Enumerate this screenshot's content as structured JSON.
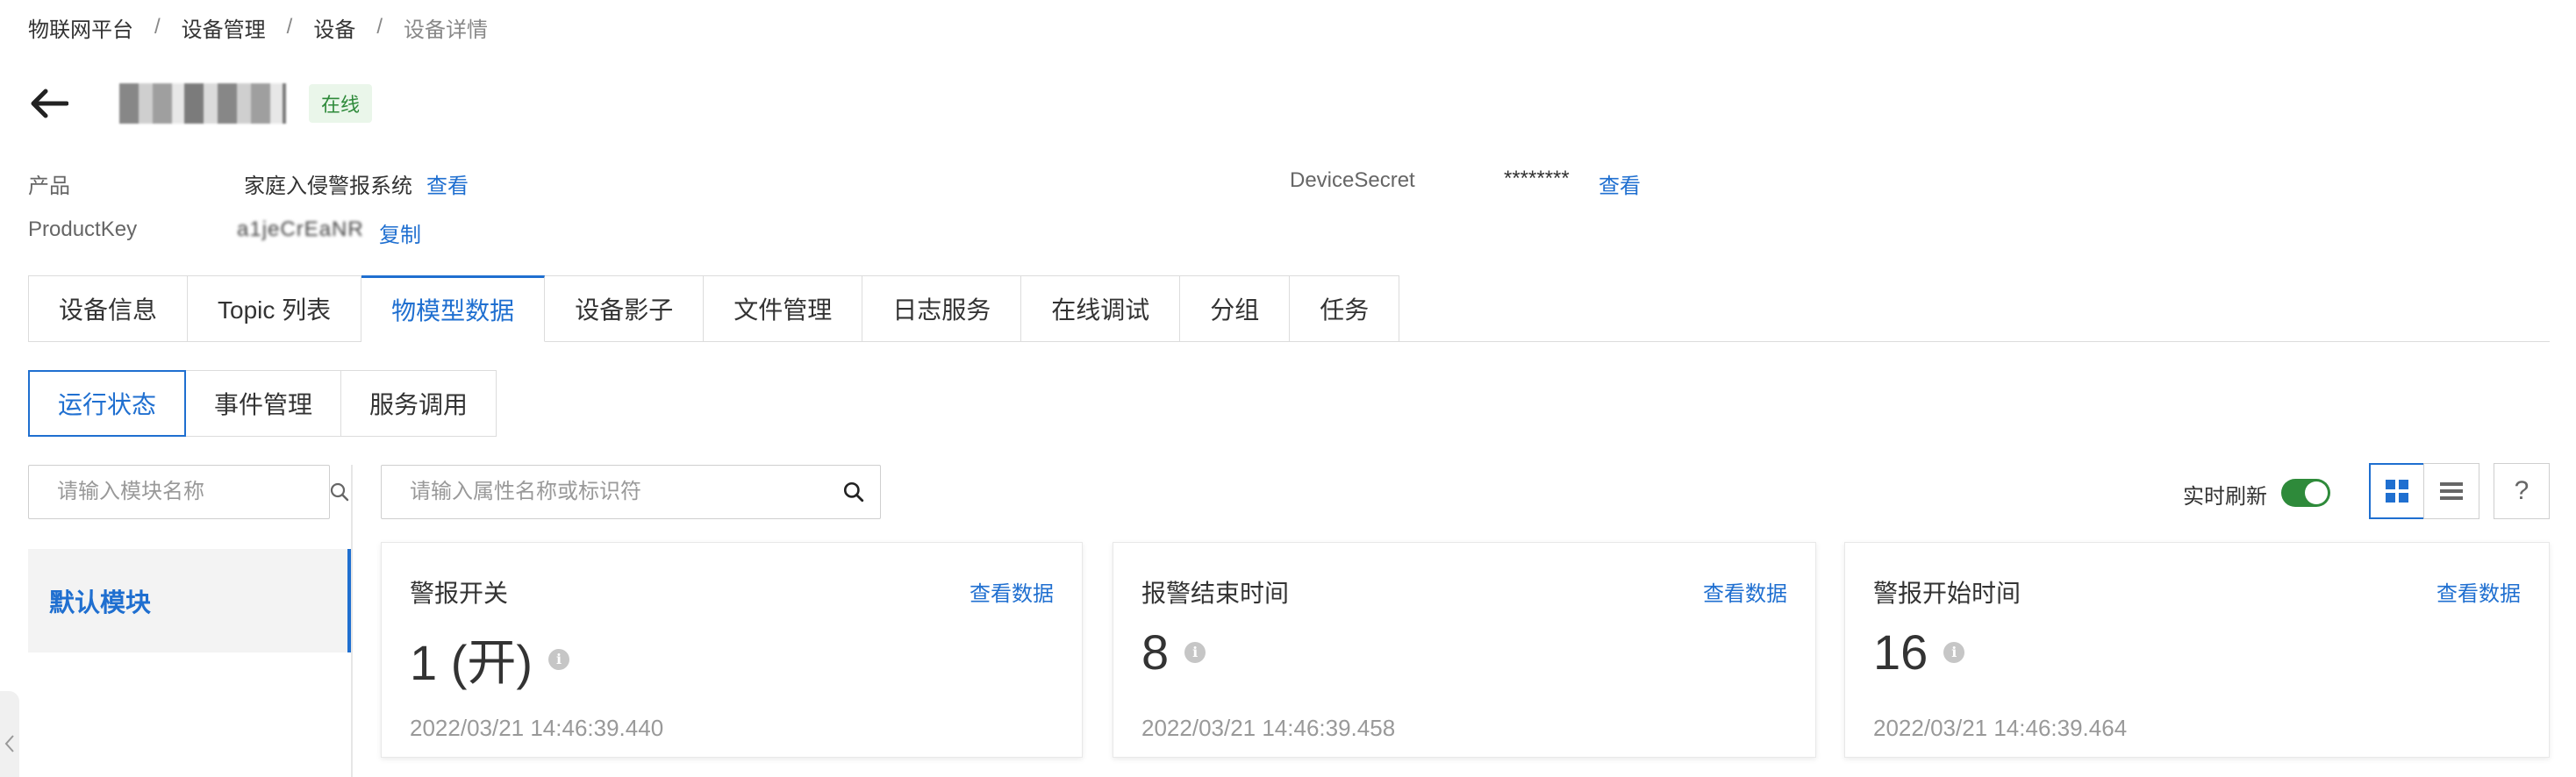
{
  "breadcrumb": {
    "items": [
      "物联网平台",
      "设备管理",
      "设备",
      "设备详情"
    ],
    "separator": "/"
  },
  "header": {
    "status": "在线"
  },
  "info": {
    "product_label": "产品",
    "product_value": "家庭入侵警报系统",
    "product_link": "查看",
    "device_secret_label": "DeviceSecret",
    "device_secret_value": "********",
    "device_secret_link": "查看",
    "product_key_label": "ProductKey",
    "product_key_value": "a1jeCrEaNR",
    "product_key_link": "复制"
  },
  "main_tabs": [
    "设备信息",
    "Topic 列表",
    "物模型数据",
    "设备影子",
    "文件管理",
    "日志服务",
    "在线调试",
    "分组",
    "任务"
  ],
  "sub_tabs": [
    "运行状态",
    "事件管理",
    "服务调用"
  ],
  "module_search": {
    "placeholder": "请输入模块名称"
  },
  "property_search": {
    "placeholder": "请输入属性名称或标识符"
  },
  "modules": [
    "默认模块"
  ],
  "toolbar": {
    "realtime_refresh_label": "实时刷新",
    "realtime_refresh_on": true,
    "help": "?"
  },
  "cards": [
    {
      "title": "警报开关",
      "link": "查看数据",
      "value": "1 (开)",
      "time": "2022/03/21 14:46:39.440"
    },
    {
      "title": "报警结束时间",
      "link": "查看数据",
      "value": "8",
      "time": "2022/03/21 14:46:39.458"
    },
    {
      "title": "警报开始时间",
      "link": "查看数据",
      "value": "16",
      "time": "2022/03/21 14:46:39.464"
    }
  ],
  "colors": {
    "accent": "#1f6fd0",
    "online_bg": "#eaf6ea",
    "online_text": "#2e8a3a",
    "toggle_on": "#2e8a3a"
  }
}
